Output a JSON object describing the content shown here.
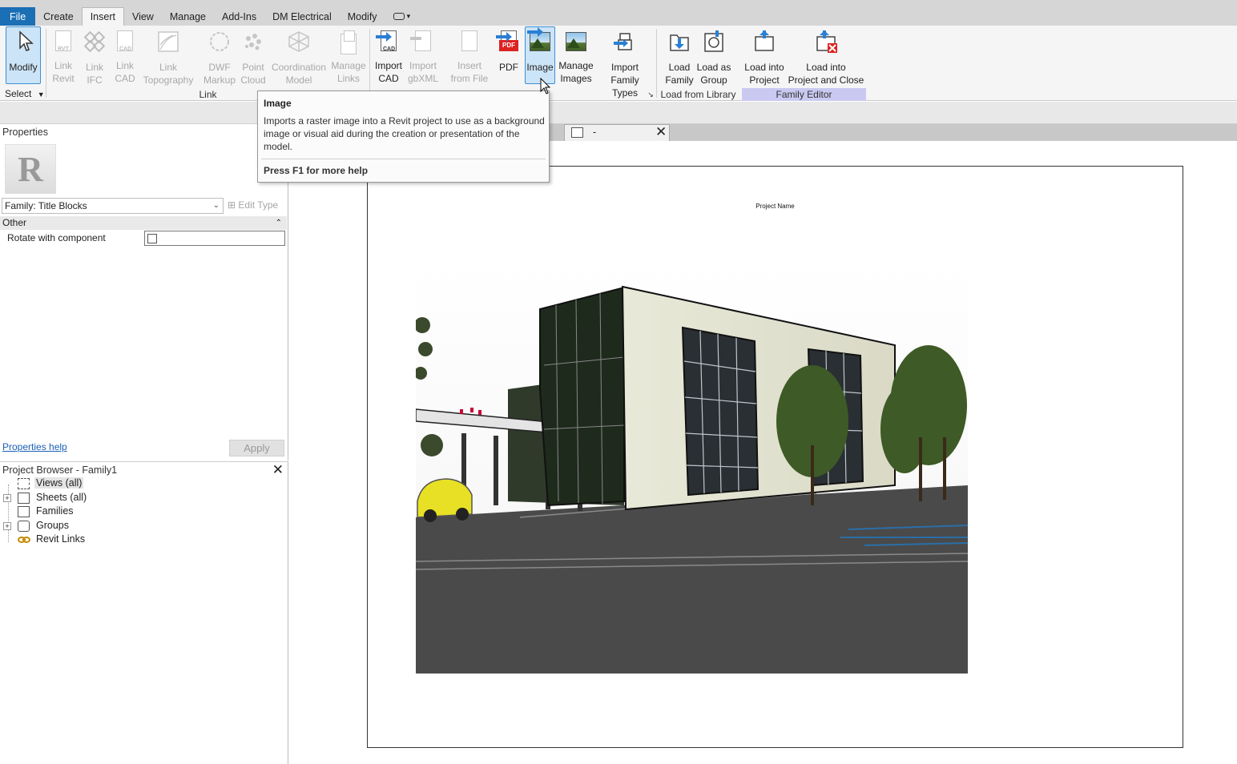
{
  "menu": {
    "tabs": [
      "File",
      "Create",
      "Insert",
      "View",
      "Manage",
      "Add-Ins",
      "DM Electrical",
      "Modify"
    ],
    "active_tab": "Insert"
  },
  "ribbon": {
    "modify": "Modify",
    "select": "Select",
    "link_revit": "Link\nRevit",
    "link_ifc": "Link\nIFC",
    "link_cad": "Link\nCAD",
    "link_topography": "Link\nTopography",
    "dwf_markup": "DWF\nMarkup",
    "point_cloud": "Point\nCloud",
    "coordination_model": "Coordination\nModel",
    "manage_links": "Manage\nLinks",
    "import_cad": "Import\nCAD",
    "import_gbxml": "Import\ngbXML",
    "insert_from_file": "Insert\nfrom File",
    "pdf": "PDF",
    "image": "Image",
    "manage_images": "Manage\nImages",
    "import_family_types": "Import\nFamily Types",
    "load_family": "Load\nFamily",
    "load_as_group": "Load as\nGroup",
    "load_into_project": "Load into\nProject",
    "load_into_project_close": "Load into\nProject and Close",
    "panel_link": "Link",
    "panel_load_from_library": "Load from Library",
    "panel_family_editor": "Family Editor",
    "cad_tag": "CAD",
    "rvt_tag": "RVT",
    "pdf_tag": "PDF"
  },
  "tooltip": {
    "title": "Image",
    "body": "Imports a raster image into a Revit project to use as a background image or visual aid during the creation or presentation of the model.",
    "help": "Press F1 for more help"
  },
  "properties": {
    "title": "Properties",
    "type_letter": "R",
    "family_selector": "Family: Title Blocks",
    "edit_type": "Edit Type",
    "group_other": "Other",
    "param_name": "Rotate with component",
    "param_checked": false,
    "help_link": "Properties help",
    "apply": "Apply"
  },
  "browser": {
    "title": "Project Browser - Family1",
    "nodes": [
      {
        "label": "Views (all)",
        "expandable": false,
        "selected": true
      },
      {
        "label": "Sheets (all)",
        "expandable": true,
        "selected": false
      },
      {
        "label": "Families",
        "expandable": false,
        "selected": false
      },
      {
        "label": "Groups",
        "expandable": true,
        "selected": false
      },
      {
        "label": "Revit Links",
        "expandable": false,
        "selected": false
      }
    ]
  },
  "view": {
    "tab_name": "-",
    "sheet_project_name": "Project Name"
  },
  "colors": {
    "file_tab": "#1a6fb5",
    "family_editor_panel": "#c9c9f2",
    "selected_button": "#cce4f7"
  }
}
